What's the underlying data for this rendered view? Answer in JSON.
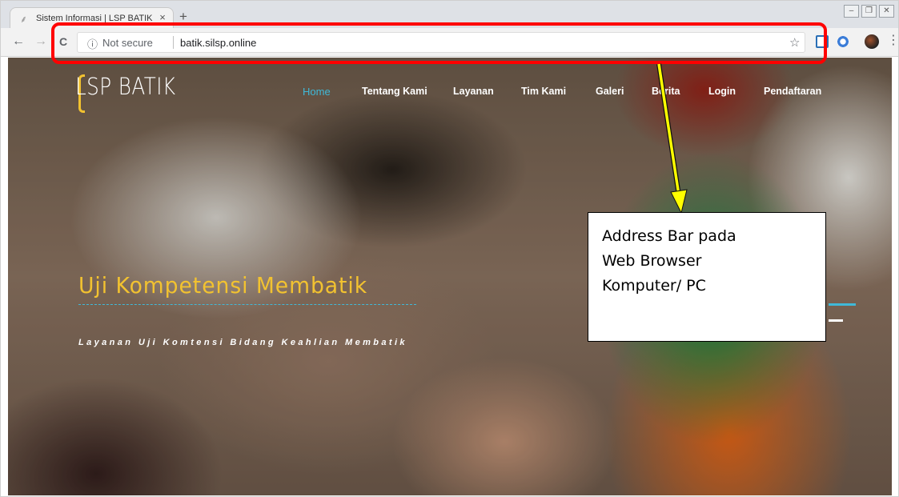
{
  "browser": {
    "tab": {
      "title": "Sistem Informasi | LSP BATIK",
      "close_glyph": "×",
      "favicon": "batik-favicon"
    },
    "new_tab_glyph": "+",
    "window_controls": [
      "–",
      "❐",
      "✕"
    ],
    "nav": {
      "back": "←",
      "forward": "→",
      "reload": "C"
    },
    "omnibox": {
      "security_icon": "ⓘ",
      "security_text": "Not secure",
      "url": "batik.silsp.online",
      "bookmark_glyph": "☆"
    },
    "extensions": [
      "s-extension-icon",
      "circle-extension-icon"
    ],
    "menu_glyph": "⋮"
  },
  "site": {
    "brand": "LSP BATIK",
    "nav": [
      "Home",
      "Tentang Kami",
      "Layanan",
      "Tim Kami",
      "Galeri",
      "Berita",
      "Login",
      "Pendaftaran"
    ],
    "active_nav": "Home",
    "hero_title": "Uji Kompetensi Membatik",
    "hero_subtitle": "Layanan Uji Komtensi Bidang Keahlian Membatik"
  },
  "annotation": {
    "lines": [
      "Address Bar pada",
      "Web Browser",
      "Komputer/ PC"
    ],
    "box_color": "#ff0000",
    "arrow_color": "#ffff00"
  },
  "colors": {
    "accent_blue": "#3fb9d9",
    "accent_yellow": "#f2c230"
  }
}
